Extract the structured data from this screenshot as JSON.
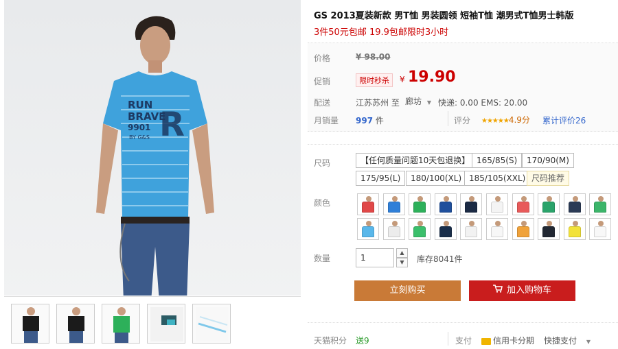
{
  "product": {
    "title": "GS 2013夏装新款 男T恤 男装圆领 短袖T恤 潮男式T恤男士韩版",
    "subtitle": "3件50元包邮 19.9包邮限时3小时"
  },
  "shirt_print": {
    "line1": "RUN",
    "line2": "BRAVE",
    "line3": "9901",
    "line4": "BY G&S",
    "big_letter": "R"
  },
  "price": {
    "label": "价格",
    "original": "¥ 98.00"
  },
  "promo": {
    "label": "促销",
    "tag": "限时秒杀",
    "currency": "¥",
    "price": "19.90"
  },
  "shipping": {
    "label": "配送",
    "from": "江苏苏州 至",
    "to": "廊坊",
    "fees": "快递: 0.00  EMS: 20.00"
  },
  "sales": {
    "label": "月销量",
    "count": "997",
    "unit": "件",
    "rating_label": "评分",
    "stars": "★★★★★",
    "rating": "4.9分",
    "reviews": "累计评价26"
  },
  "size": {
    "label": "尺码",
    "options": [
      "【任何质量问题10天包退换】",
      "165/85(S)",
      "170/90(M)",
      "175/95(L)",
      "180/100(XL)",
      "185/105(XXL)"
    ],
    "guide": "尺码推荐"
  },
  "color": {
    "label": "颜色",
    "swatches": [
      "#e04848",
      "#2f7fd8",
      "#2db05a",
      "#1f4f9c",
      "#1b2a44",
      "#f4f4f4",
      "#e85a5a",
      "#2aa36a",
      "#2b3a55",
      "#3cb56a",
      "#59b7ea",
      "#ececec",
      "#3bbf6b",
      "#1a2e4a",
      "#f2f2f2",
      "#f7f7f7",
      "#f0a23a",
      "#222833",
      "#f2e23a",
      "#f8f8f8"
    ]
  },
  "quantity": {
    "label": "数量",
    "value": "1",
    "stock": "库存8041件"
  },
  "actions": {
    "buy": "立刻购买",
    "cart": "加入购物车"
  },
  "footer": {
    "points_label": "天猫积分",
    "points": "送9",
    "pay_label": "支付",
    "card_pay": "信用卡分期",
    "quick_pay": "快捷支付"
  },
  "colors": {
    "accent_red": "#c00000",
    "buy_orange": "#c97a37",
    "cart_red": "#c91d1d"
  }
}
